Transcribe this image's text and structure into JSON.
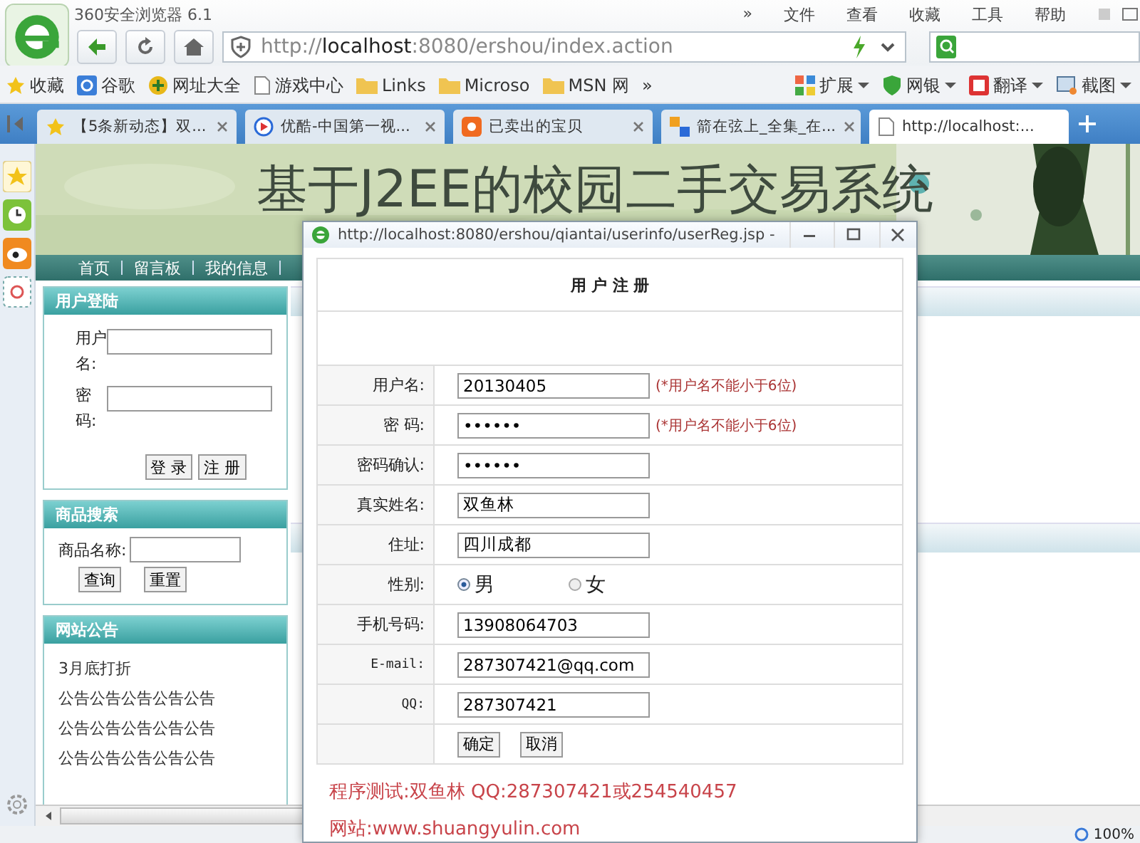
{
  "browser": {
    "title": "360安全浏览器 6.1",
    "menu": [
      "»",
      "文件",
      "查看",
      "收藏",
      "工具",
      "帮助"
    ],
    "address": "http://**localhost**:8080/ershou/index.action"
  },
  "bookmarks": [
    {
      "label": "收藏",
      "kind": "star"
    },
    {
      "label": "谷歌",
      "kind": "g"
    },
    {
      "label": "网址大全",
      "kind": "plus"
    },
    {
      "label": "游戏中心",
      "kind": "page"
    },
    {
      "label": "Links",
      "kind": "folder"
    },
    {
      "label": "Microso",
      "kind": "folder"
    },
    {
      "label": "MSN 网",
      "kind": "folder"
    }
  ],
  "bookmarks_more": "»",
  "extensions": [
    {
      "label": "扩展",
      "kind": "grid"
    },
    {
      "label": "网银",
      "kind": "shield"
    },
    {
      "label": "翻译",
      "kind": "translate"
    },
    {
      "label": "截图",
      "kind": "scissors"
    }
  ],
  "tabs": [
    {
      "label": "【5条新动态】双...",
      "selected": false,
      "kind": "star"
    },
    {
      "label": "优酷-中国第一视...",
      "selected": false,
      "kind": "play"
    },
    {
      "label": "已卖出的宝贝",
      "selected": false,
      "kind": "shop"
    },
    {
      "label": "箭在弦上_全集_在...",
      "selected": false,
      "kind": "soku"
    },
    {
      "label": "http://localhost:...",
      "selected": true,
      "kind": "page"
    }
  ],
  "page": {
    "site_title": "基于J2EE的校园二手交易系统",
    "nav": [
      "首页",
      "留言板",
      "我的信息"
    ],
    "login": {
      "title": "用户登陆",
      "fields": [
        {
          "label": "用户名:"
        },
        {
          "label": "密码:"
        }
      ],
      "buttons": [
        "登 录",
        "注 册"
      ]
    },
    "search": {
      "title": "商品搜索",
      "label": "商品名称:",
      "buttons": [
        "查询",
        "重置"
      ]
    },
    "notice": {
      "title": "网站公告",
      "items": [
        "3月底打折",
        "公告公告公告公告公告",
        "公告公告公告公告公告",
        "公告公告公告公告公告"
      ]
    }
  },
  "popup": {
    "title": "http://localhost:8080/ershou/qiantai/userinfo/userReg.jsp -",
    "form_title": "用 户 注 册",
    "rows": [
      {
        "kind": "text",
        "label": "用户名:",
        "value": "20130405",
        "hint": "(*用户名不能小于6位)"
      },
      {
        "kind": "password",
        "label": "密 码:",
        "value": "••••••",
        "hint": "(*用户名不能小于6位)"
      },
      {
        "kind": "password",
        "label": "密码确认:",
        "value": "••••••"
      },
      {
        "kind": "text",
        "label": "真实姓名:",
        "value": "双鱼林"
      },
      {
        "kind": "text",
        "label": "住址:",
        "value": "四川成都"
      },
      {
        "kind": "radio",
        "label": "性别:",
        "options": [
          {
            "label": "男",
            "selected": true
          },
          {
            "label": "女",
            "selected": false
          }
        ]
      },
      {
        "kind": "text",
        "label": "手机号码:",
        "value": "13908064703"
      },
      {
        "kind": "text",
        "label": "E-mail:",
        "value": "287307421@qq.com",
        "mono": true
      },
      {
        "kind": "text",
        "label": "QQ:",
        "value": "287307421",
        "mono": true
      },
      {
        "kind": "buttons",
        "buttons": [
          "确定",
          "取消"
        ]
      }
    ],
    "footer": [
      "程序测试:双鱼林 QQ:287307421或254540457",
      "网站:www.shuangyulin.com"
    ]
  },
  "status": {
    "zoom": "100%"
  }
}
